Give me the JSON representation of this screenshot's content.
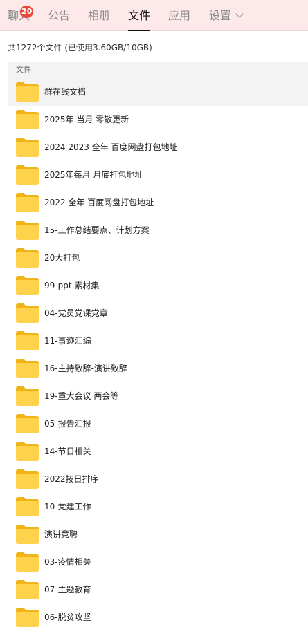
{
  "tabs": [
    {
      "label": "聊天",
      "badge": "20",
      "active": false
    },
    {
      "label": "公告",
      "active": false
    },
    {
      "label": "相册",
      "active": false
    },
    {
      "label": "文件",
      "active": true
    },
    {
      "label": "应用",
      "active": false
    },
    {
      "label": "设置",
      "active": false,
      "dropdown": true
    }
  ],
  "summary": "共1272个文件 (已使用3.60GB/10GB)",
  "list_header": "文件",
  "colors": {
    "tabbar_bg": "#fde9e9",
    "badge": "#e8473b",
    "folder_body": "#ffd24c",
    "folder_tab": "#f0b418",
    "row_highlight": "#f3f3f3"
  },
  "folders": [
    {
      "name": "群在线文档",
      "icon": "folder-icon"
    },
    {
      "name": "2025年 当月 零散更新",
      "icon": "folder-icon"
    },
    {
      "name": "2024 2023 全年 百度网盘打包地址",
      "icon": "folder-icon"
    },
    {
      "name": "2025年每月 月底打包地址",
      "icon": "folder-icon"
    },
    {
      "name": "2022 全年 百度网盘打包地址",
      "icon": "folder-icon"
    },
    {
      "name": "15-工作总结要点、计划方案",
      "icon": "folder-icon"
    },
    {
      "name": "20大打包",
      "icon": "folder-icon"
    },
    {
      "name": "99-ppt 素材集",
      "icon": "folder-icon"
    },
    {
      "name": "04-党员党课党章",
      "icon": "folder-icon"
    },
    {
      "name": "11-事迹汇编",
      "icon": "folder-icon"
    },
    {
      "name": "16-主持致辞-演讲致辞",
      "icon": "folder-icon"
    },
    {
      "name": "19-重大会议 两会等",
      "icon": "folder-icon"
    },
    {
      "name": "05-报告汇报",
      "icon": "folder-icon"
    },
    {
      "name": "14-节日相关",
      "icon": "folder-icon"
    },
    {
      "name": "2022按日排序",
      "icon": "folder-icon"
    },
    {
      "name": "10-党建工作",
      "icon": "folder-icon"
    },
    {
      "name": "演讲竞聘",
      "icon": "folder-icon"
    },
    {
      "name": "03-疫情相关",
      "icon": "folder-icon"
    },
    {
      "name": "07-主题教育",
      "icon": "folder-icon"
    },
    {
      "name": "06-脱贫攻坚",
      "icon": "folder-icon"
    }
  ]
}
